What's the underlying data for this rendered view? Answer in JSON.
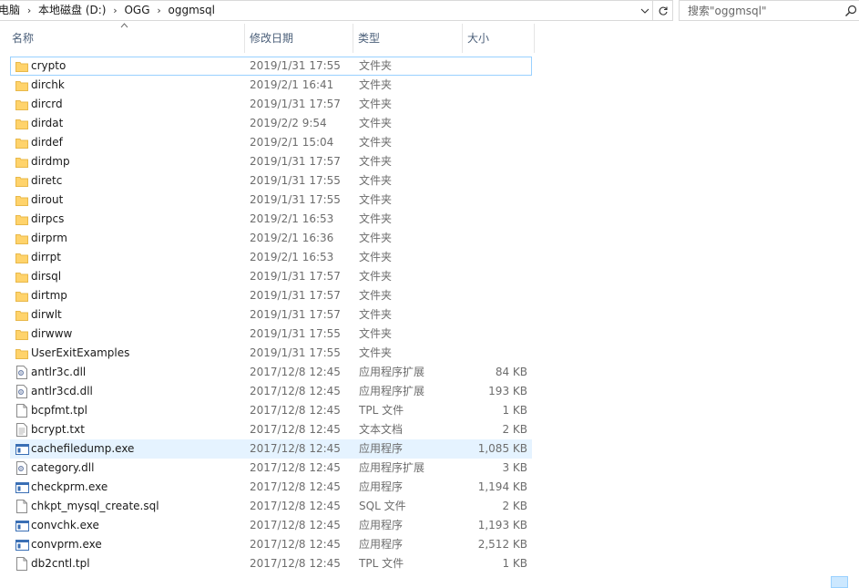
{
  "address": {
    "crumbs": [
      "电脑",
      "本地磁盘 (D:)",
      "OGG",
      "oggmsql"
    ],
    "separator": "›"
  },
  "search": {
    "placeholder": "搜索\"oggmsql\""
  },
  "columns": {
    "name": "名称",
    "date": "修改日期",
    "type": "类型",
    "size": "大小"
  },
  "files": [
    {
      "name": "crypto",
      "date": "2019/1/31 17:55",
      "type": "文件夹",
      "size": "",
      "icon": "folder-icon"
    },
    {
      "name": "dirchk",
      "date": "2019/2/1 16:41",
      "type": "文件夹",
      "size": "",
      "icon": "folder-icon"
    },
    {
      "name": "dircrd",
      "date": "2019/1/31 17:57",
      "type": "文件夹",
      "size": "",
      "icon": "folder-icon"
    },
    {
      "name": "dirdat",
      "date": "2019/2/2 9:54",
      "type": "文件夹",
      "size": "",
      "icon": "folder-icon"
    },
    {
      "name": "dirdef",
      "date": "2019/2/1 15:04",
      "type": "文件夹",
      "size": "",
      "icon": "folder-icon"
    },
    {
      "name": "dirdmp",
      "date": "2019/1/31 17:57",
      "type": "文件夹",
      "size": "",
      "icon": "folder-icon"
    },
    {
      "name": "diretc",
      "date": "2019/1/31 17:55",
      "type": "文件夹",
      "size": "",
      "icon": "folder-icon"
    },
    {
      "name": "dirout",
      "date": "2019/1/31 17:55",
      "type": "文件夹",
      "size": "",
      "icon": "folder-icon"
    },
    {
      "name": "dirpcs",
      "date": "2019/2/1 16:53",
      "type": "文件夹",
      "size": "",
      "icon": "folder-icon"
    },
    {
      "name": "dirprm",
      "date": "2019/2/1 16:36",
      "type": "文件夹",
      "size": "",
      "icon": "folder-icon"
    },
    {
      "name": "dirrpt",
      "date": "2019/2/1 16:53",
      "type": "文件夹",
      "size": "",
      "icon": "folder-icon"
    },
    {
      "name": "dirsql",
      "date": "2019/1/31 17:57",
      "type": "文件夹",
      "size": "",
      "icon": "folder-icon"
    },
    {
      "name": "dirtmp",
      "date": "2019/1/31 17:57",
      "type": "文件夹",
      "size": "",
      "icon": "folder-icon"
    },
    {
      "name": "dirwlt",
      "date": "2019/1/31 17:57",
      "type": "文件夹",
      "size": "",
      "icon": "folder-icon"
    },
    {
      "name": "dirwww",
      "date": "2019/1/31 17:55",
      "type": "文件夹",
      "size": "",
      "icon": "folder-icon"
    },
    {
      "name": "UserExitExamples",
      "date": "2019/1/31 17:55",
      "type": "文件夹",
      "size": "",
      "icon": "folder-icon"
    },
    {
      "name": "antlr3c.dll",
      "date": "2017/12/8 12:45",
      "type": "应用程序扩展",
      "size": "84 KB",
      "icon": "dll-icon"
    },
    {
      "name": "antlr3cd.dll",
      "date": "2017/12/8 12:45",
      "type": "应用程序扩展",
      "size": "193 KB",
      "icon": "dll-icon"
    },
    {
      "name": "bcpfmt.tpl",
      "date": "2017/12/8 12:45",
      "type": "TPL 文件",
      "size": "1 KB",
      "icon": "file-icon"
    },
    {
      "name": "bcrypt.txt",
      "date": "2017/12/8 12:45",
      "type": "文本文档",
      "size": "2 KB",
      "icon": "text-file-icon"
    },
    {
      "name": "cachefiledump.exe",
      "date": "2017/12/8 12:45",
      "type": "应用程序",
      "size": "1,085 KB",
      "icon": "exe-icon"
    },
    {
      "name": "category.dll",
      "date": "2017/12/8 12:45",
      "type": "应用程序扩展",
      "size": "3 KB",
      "icon": "dll-icon"
    },
    {
      "name": "checkprm.exe",
      "date": "2017/12/8 12:45",
      "type": "应用程序",
      "size": "1,194 KB",
      "icon": "exe-icon"
    },
    {
      "name": "chkpt_mysql_create.sql",
      "date": "2017/12/8 12:45",
      "type": "SQL 文件",
      "size": "2 KB",
      "icon": "file-icon"
    },
    {
      "name": "convchk.exe",
      "date": "2017/12/8 12:45",
      "type": "应用程序",
      "size": "1,193 KB",
      "icon": "exe-icon"
    },
    {
      "name": "convprm.exe",
      "date": "2017/12/8 12:45",
      "type": "应用程序",
      "size": "2,512 KB",
      "icon": "exe-icon"
    },
    {
      "name": "db2cntl.tpl",
      "date": "2017/12/8 12:45",
      "type": "TPL 文件",
      "size": "1 KB",
      "icon": "file-icon"
    }
  ],
  "state": {
    "focused_row": 0,
    "hover_row": 20
  },
  "colors": {
    "folder": "#ffd36b",
    "folder_dark": "#e8b84a",
    "hover": "#e5f3ff",
    "focus_border": "#99d1ff",
    "header_text": "#4c607a"
  }
}
